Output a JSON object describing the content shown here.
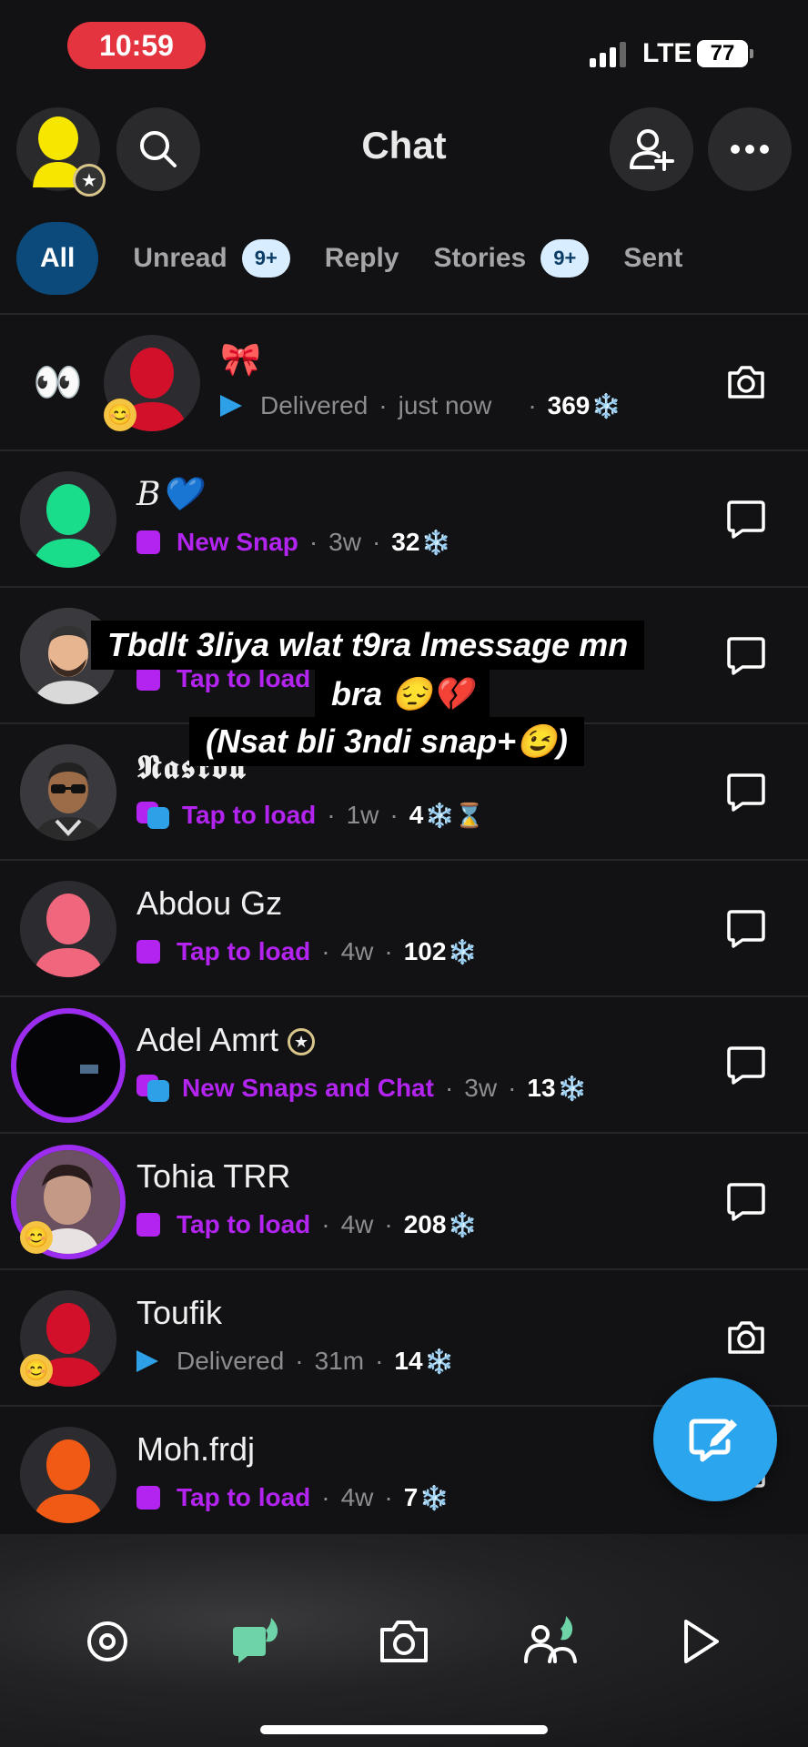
{
  "status_bar": {
    "time": "10:59",
    "network": "LTE",
    "battery": "77"
  },
  "header": {
    "title": "Chat"
  },
  "tabs": [
    {
      "label": "All",
      "badge": ""
    },
    {
      "label": "Unread",
      "badge": "9+"
    },
    {
      "label": "Reply",
      "badge": ""
    },
    {
      "label": "Stories",
      "badge": "9+"
    },
    {
      "label": "Sent",
      "badge": ""
    }
  ],
  "chats": [
    {
      "name": "🎀",
      "status": "Delivered",
      "time": "just now",
      "streak": "369",
      "emoji": "👀",
      "action_icon": "camera-icon"
    },
    {
      "name": "𝐵💙",
      "status": "New Snap",
      "time": "3w",
      "streak": "32",
      "action_icon": "chat-icon"
    },
    {
      "name": "",
      "status": "Tap to load",
      "time": "",
      "streak": "",
      "action_icon": "chat-icon"
    },
    {
      "name": "𝕹𝖆𝖘𝖗𝖔𝖚",
      "status": "Tap to load",
      "time": "1w",
      "streak": "4",
      "extra": "⌛",
      "action_icon": "chat-icon"
    },
    {
      "name": "Abdou Gz",
      "status": "Tap to load",
      "time": "4w",
      "streak": "102",
      "action_icon": "chat-icon"
    },
    {
      "name": "Adel Amrt",
      "status": "New Snaps and Chat",
      "time": "3w",
      "streak": "13",
      "action_icon": "chat-icon"
    },
    {
      "name": "Tohia TRR",
      "status": "Tap to load",
      "time": "4w",
      "streak": "208",
      "action_icon": "chat-icon"
    },
    {
      "name": "Toufik",
      "status": "Delivered",
      "time": "31m",
      "streak": "14",
      "action_icon": "camera-icon"
    },
    {
      "name": "Moh.frdj",
      "status": "Tap to load",
      "time": "4w",
      "streak": "7",
      "action_icon": "chat-icon"
    }
  ],
  "caption": {
    "line1": "Tbdlt 3liya wlat t9ra lmessage mn",
    "line2": "bra 😔💔",
    "line3": "(Nsat bli 3ndi snap+😉)"
  },
  "streak_symbol": "❄️",
  "colors": {
    "accent_blue": "#2aa5ee",
    "purple": "#b324f0",
    "time_pill": "#e4343f",
    "tab_active": "#0b4a7b"
  }
}
